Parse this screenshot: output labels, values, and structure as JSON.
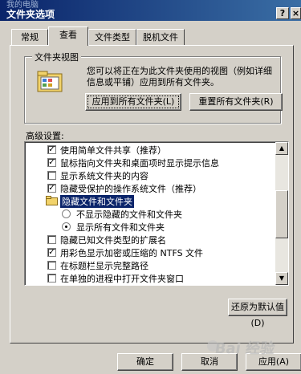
{
  "window": {
    "title": "文件夹选项",
    "background_text": "我的电脑",
    "help_glyph": "?",
    "close_glyph": "×"
  },
  "tabs": [
    "常规",
    "查看",
    "文件类型",
    "脱机文件"
  ],
  "folder_views": {
    "title": "文件夹视图",
    "description": "您可以将正在为此文件夹使用的视图（例如详细信息或平铺）应用到所有文件夹。",
    "apply_all_label": "应用到所有文件夹(L)",
    "reset_all_label": "重置所有文件夹(R)"
  },
  "advanced": {
    "label": "高级设置:",
    "items": [
      {
        "type": "checkbox",
        "checked": true,
        "label": "使用简单文件共享（推荐）"
      },
      {
        "type": "checkbox",
        "checked": true,
        "label": "鼠标指向文件夹和桌面项时显示提示信息"
      },
      {
        "type": "checkbox",
        "checked": false,
        "label": "显示系统文件夹的内容"
      },
      {
        "type": "checkbox",
        "checked": true,
        "label": "隐藏受保护的操作系统文件（推荐）"
      },
      {
        "type": "folder",
        "label": "隐藏文件和文件夹"
      },
      {
        "type": "radio",
        "checked": false,
        "label": "不显示隐藏的文件和文件夹"
      },
      {
        "type": "radio",
        "checked": true,
        "label": "显示所有文件和文件夹"
      },
      {
        "type": "checkbox",
        "checked": false,
        "label": "隐藏已知文件类型的扩展名"
      },
      {
        "type": "checkbox",
        "checked": true,
        "label": "用彩色显示加密或压缩的 NTFS 文件"
      },
      {
        "type": "checkbox",
        "checked": false,
        "label": "在标题栏显示完整路径"
      },
      {
        "type": "checkbox",
        "checked": false,
        "label": "在单独的进程中打开文件夹窗口"
      }
    ]
  },
  "restore_label": "还原为默认值(D)",
  "buttons": {
    "ok": "确定",
    "cancel": "取消",
    "apply": "应用(A)"
  },
  "watermark": "Bai 经验"
}
